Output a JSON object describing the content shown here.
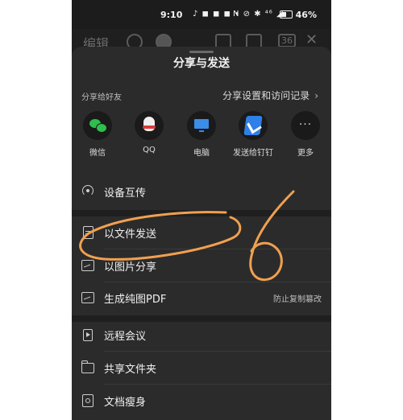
{
  "status_bar": {
    "time": "9:10",
    "notification_icons": "♪ ◼ ◼ ◼ •",
    "system_icons": "N ⊘ ✱ ⁴⁶ ◢",
    "battery": "46%"
  },
  "toolbar": {
    "edit_label": "编辑",
    "page_count": "36"
  },
  "sheet": {
    "title": "分享与发送",
    "share_to_friends": "分享给好友",
    "share_settings": "分享设置和访问记录",
    "settings_chevron": "›",
    "apps": [
      {
        "label": "微信",
        "icon": "wechat-icon"
      },
      {
        "label": "QQ",
        "icon": "qq-icon"
      },
      {
        "label": "电脑",
        "icon": "computer-icon"
      },
      {
        "label": "发送给钉钉",
        "icon": "dingtalk-icon"
      },
      {
        "label": "更多",
        "icon": "more-icon",
        "glyph": "···"
      }
    ],
    "device_transfer": "设备互传",
    "send_as_file": "以文件发送",
    "share_as_image": "以图片分享",
    "generate_pdf": "生成纯图PDF",
    "pdf_note": "防止复制篡改",
    "remote_meeting": "远程会议",
    "shared_folder": "共享文件夹",
    "doc_slim": "文档瘦身"
  },
  "annotation": {
    "handwritten_mark": "6"
  }
}
